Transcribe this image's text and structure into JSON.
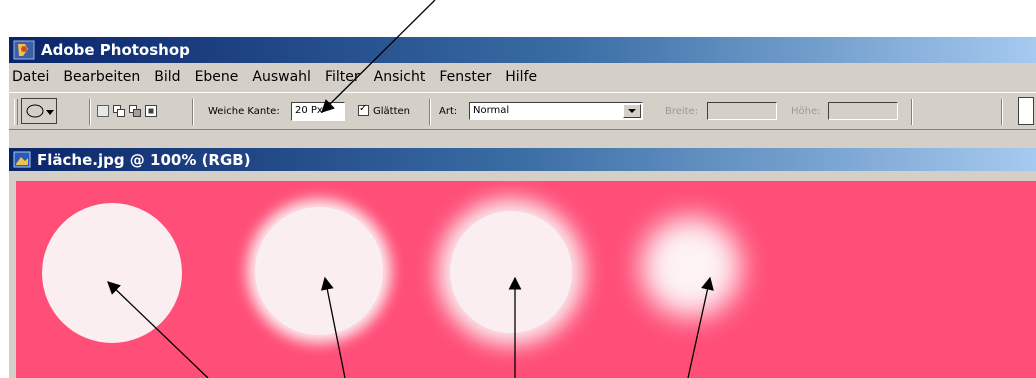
{
  "app": {
    "title": "Adobe Photoshop"
  },
  "menu": [
    "Datei",
    "Bearbeiten",
    "Bild",
    "Ebene",
    "Auswahl",
    "Filter",
    "Ansicht",
    "Fenster",
    "Hilfe"
  ],
  "options_bar": {
    "feather_label": "Weiche Kante:",
    "feather_value": "20 Px",
    "antialias_label": "Glätten",
    "antialias_checked": "✓",
    "style_label": "Art:",
    "style_value": "Normal",
    "width_label": "Breite:",
    "height_label": "Höhe:"
  },
  "document": {
    "title": "Fläche.jpg @ 100% (RGB)"
  },
  "colors": {
    "canvas": "#ff4e77",
    "circle": "#fbeef0",
    "title_bar": "#0a246a"
  },
  "icons": [
    "photoshop-icon",
    "elliptical-marquee-icon",
    "dropdown-arrow-icon",
    "new-selection-icon",
    "add-selection-icon",
    "subtract-selection-icon",
    "intersect-selection-icon",
    "document-icon",
    "palette-well-icon"
  ]
}
